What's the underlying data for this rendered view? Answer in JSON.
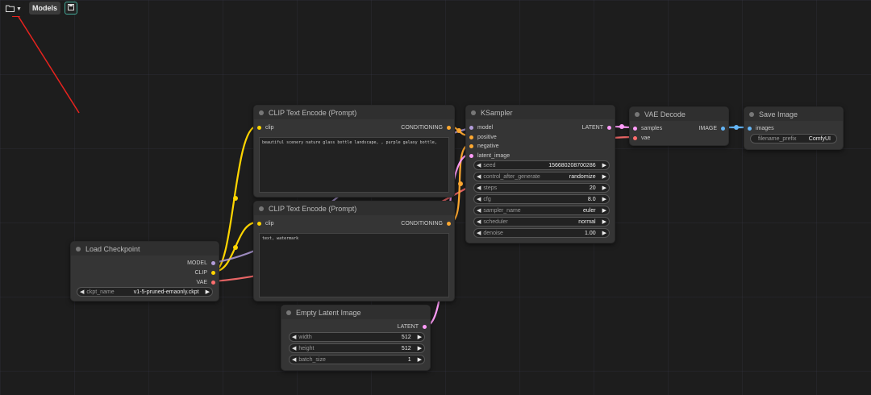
{
  "topbar": {
    "models_label": "Models",
    "folder_icon": "folder-icon",
    "save_icon": "save-icon"
  },
  "colors": {
    "clip": "#ffd500",
    "model": "#b39ddb",
    "vae": "#ff6e6e",
    "conditioning": "#ffa931",
    "latent": "#ff9cf9",
    "image": "#64b5f6"
  },
  "nodes": {
    "clip_pos": {
      "title": "CLIP Text Encode (Prompt)",
      "in_clip": "clip",
      "out_cond": "CONDITIONING",
      "text": "beautiful scenery nature glass bottle landscape, , purple galaxy bottle,"
    },
    "clip_neg": {
      "title": "CLIP Text Encode (Prompt)",
      "in_clip": "clip",
      "out_cond": "CONDITIONING",
      "text": "text, watermark"
    },
    "checkpoint": {
      "title": "Load Checkpoint",
      "out_model": "MODEL",
      "out_clip": "CLIP",
      "out_vae": "VAE",
      "w_name": "ckpt_name",
      "w_value": "v1-5-pruned-emaonly.ckpt"
    },
    "latent": {
      "title": "Empty Latent Image",
      "out_latent": "LATENT",
      "widgets": [
        {
          "name": "width",
          "value": "512"
        },
        {
          "name": "height",
          "value": "512"
        },
        {
          "name": "batch_size",
          "value": "1"
        }
      ]
    },
    "ksampler": {
      "title": "KSampler",
      "in_model": "model",
      "in_positive": "positive",
      "in_negative": "negative",
      "in_latent": "latent_image",
      "out_latent": "LATENT",
      "widgets": [
        {
          "name": "seed",
          "value": "156680208700286"
        },
        {
          "name": "control_after_generate",
          "value": "randomize"
        },
        {
          "name": "steps",
          "value": "20"
        },
        {
          "name": "cfg",
          "value": "8.0"
        },
        {
          "name": "sampler_name",
          "value": "euler"
        },
        {
          "name": "scheduler",
          "value": "normal"
        },
        {
          "name": "denoise",
          "value": "1.00"
        }
      ]
    },
    "vae_decode": {
      "title": "VAE Decode",
      "in_samples": "samples",
      "in_vae": "vae",
      "out_image": "IMAGE"
    },
    "save": {
      "title": "Save Image",
      "in_images": "images",
      "w_name": "filename_prefix",
      "w_value": "ComfyUI"
    }
  }
}
